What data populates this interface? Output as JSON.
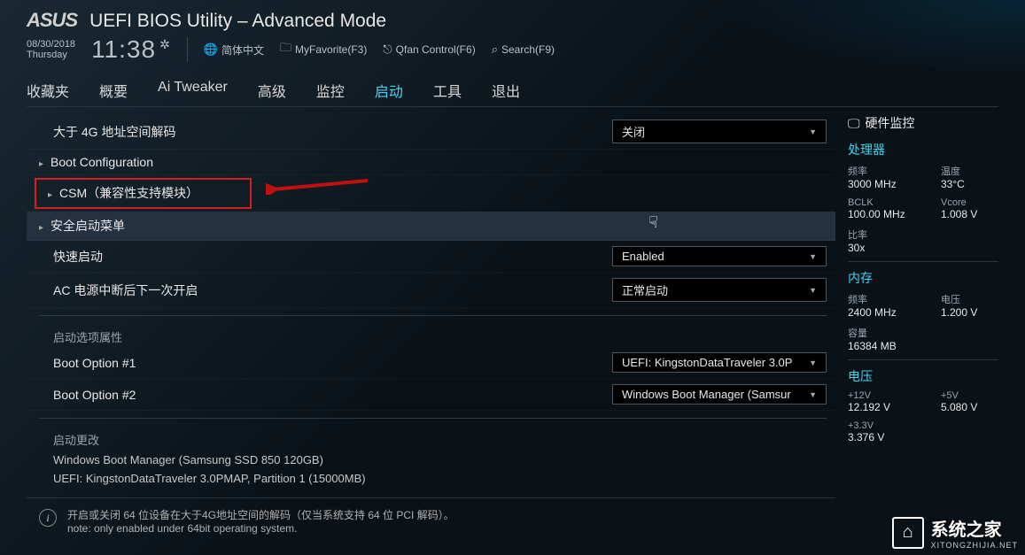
{
  "header": {
    "brand": "ASUS",
    "title": "UEFI BIOS Utility – Advanced Mode",
    "date": "08/30/2018",
    "day": "Thursday",
    "time": "11:38",
    "lang": "简体中文",
    "favorite": "MyFavorite(F3)",
    "qfan": "Qfan Control(F6)",
    "search": "Search(F9)"
  },
  "tabs": [
    "收藏夹",
    "概要",
    "Ai Tweaker",
    "高级",
    "监控",
    "启动",
    "工具",
    "退出"
  ],
  "active_tab": "启动",
  "settings": {
    "above4g": {
      "label": "大于 4G 地址空间解码",
      "value": "关闭"
    },
    "bootcfg": {
      "label": "Boot Configuration"
    },
    "csm": {
      "label": "CSM（兼容性支持模块）"
    },
    "secboot": {
      "label": "安全启动菜单"
    },
    "fastboot": {
      "label": "快速启动",
      "value": "Enabled"
    },
    "acresume": {
      "label": "AC 电源中断后下一次开启",
      "value": "正常启动"
    },
    "bootopt_head": "启动选项属性",
    "bo1": {
      "label": "Boot Option #1",
      "value": "UEFI: KingstonDataTraveler 3.0P"
    },
    "bo2": {
      "label": "Boot Option #2",
      "value": "Windows Boot Manager (Samsur"
    },
    "override_head": "启动更改",
    "override1": "Windows Boot Manager (Samsung SSD 850 120GB)",
    "override2": "UEFI: KingstonDataTraveler 3.0PMAP, Partition 1 (15000MB)",
    "hint_cn": "开启或关闭 64 位设备在大于4G地址空间的解码（仅当系统支持 64 位 PCI 解码）。",
    "hint_en": "note: only enabled under 64bit operating system."
  },
  "side": {
    "title": "硬件监控",
    "cpu_head": "处理器",
    "cpu": {
      "freq_l": "频率",
      "freq_v": "3000 MHz",
      "temp_l": "温度",
      "temp_v": "33°C",
      "bclk_l": "BCLK",
      "bclk_v": "100.00 MHz",
      "vcore_l": "Vcore",
      "vcore_v": "1.008 V",
      "ratio_l": "比率",
      "ratio_v": "30x"
    },
    "mem_head": "内存",
    "mem": {
      "freq_l": "频率",
      "freq_v": "2400 MHz",
      "volt_l": "电压",
      "volt_v": "1.200 V",
      "cap_l": "容量",
      "cap_v": "16384 MB"
    },
    "volt_head": "电压",
    "volt": {
      "v12_l": "+12V",
      "v12_v": "12.192 V",
      "v5_l": "+5V",
      "v5_v": "5.080 V",
      "v33_l": "+3.3V",
      "v33_v": "3.376 V"
    }
  },
  "watermark": {
    "big": "系统之家",
    "small": "XITONGZHIJIA.NET"
  }
}
